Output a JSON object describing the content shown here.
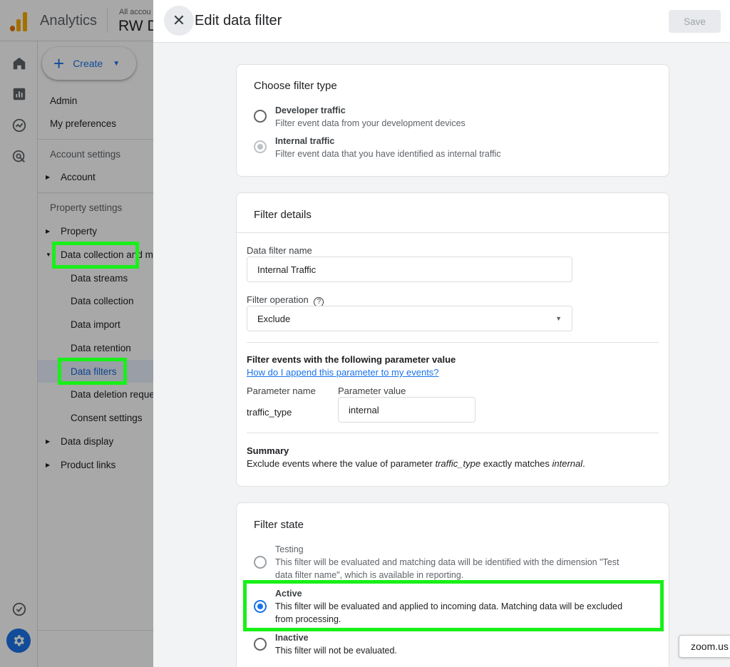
{
  "app": {
    "name": "Analytics",
    "account_label": "All accou",
    "account_name": "RW D"
  },
  "nav": {
    "create_label": "Create",
    "admin": "Admin",
    "my_preferences": "My preferences",
    "account_settings": "Account settings",
    "account": "Account",
    "property_settings": "Property settings",
    "property": "Property",
    "data_collection_group": "Data collection and m",
    "data_streams": "Data streams",
    "data_collection": "Data collection",
    "data_import": "Data import",
    "data_retention": "Data retention",
    "data_filters": "Data filters",
    "data_deletion": "Data deletion reque",
    "consent_settings": "Consent settings",
    "data_display": "Data display",
    "product_links": "Product links"
  },
  "panel": {
    "title": "Edit data filter",
    "save_label": "Save",
    "filter_type": {
      "title": "Choose filter type",
      "options": [
        {
          "label": "Developer traffic",
          "desc": "Filter event data from your development devices"
        },
        {
          "label": "Internal traffic",
          "desc": "Filter event data that you have identified as internal traffic"
        }
      ]
    },
    "details": {
      "title": "Filter details",
      "name_label": "Data filter name",
      "name_value": "Internal Traffic",
      "operation_label": "Filter operation",
      "operation_value": "Exclude",
      "param_heading": "Filter events with the following parameter value",
      "param_link": "How do I append this parameter to my events?",
      "param_name_label": "Parameter name",
      "param_value_label": "Parameter value",
      "param_name": "traffic_type",
      "param_value": "internal",
      "summary_title": "Summary",
      "summary_prefix": "Exclude events where the value of parameter ",
      "summary_param": "traffic_type",
      "summary_mid": " exactly matches ",
      "summary_value": "internal",
      "summary_suffix": "."
    },
    "state": {
      "title": "Filter state",
      "options": [
        {
          "label": "Testing",
          "desc_line1": "This filter will be evaluated and matching data will be identified with the dimension \"Test",
          "desc_line2": "data filter name\", which is available in reporting."
        },
        {
          "label": "Active",
          "desc_line1": "This filter will be evaluated and applied to incoming data. Matching data will be excluded",
          "desc_line2": "from processing."
        },
        {
          "label": "Inactive",
          "desc_line1": "This filter will not be evaluated."
        }
      ]
    }
  },
  "zoom_tooltip": "zoom.us",
  "colors": {
    "accent": "#1a73e8",
    "highlight": "#19f019"
  }
}
